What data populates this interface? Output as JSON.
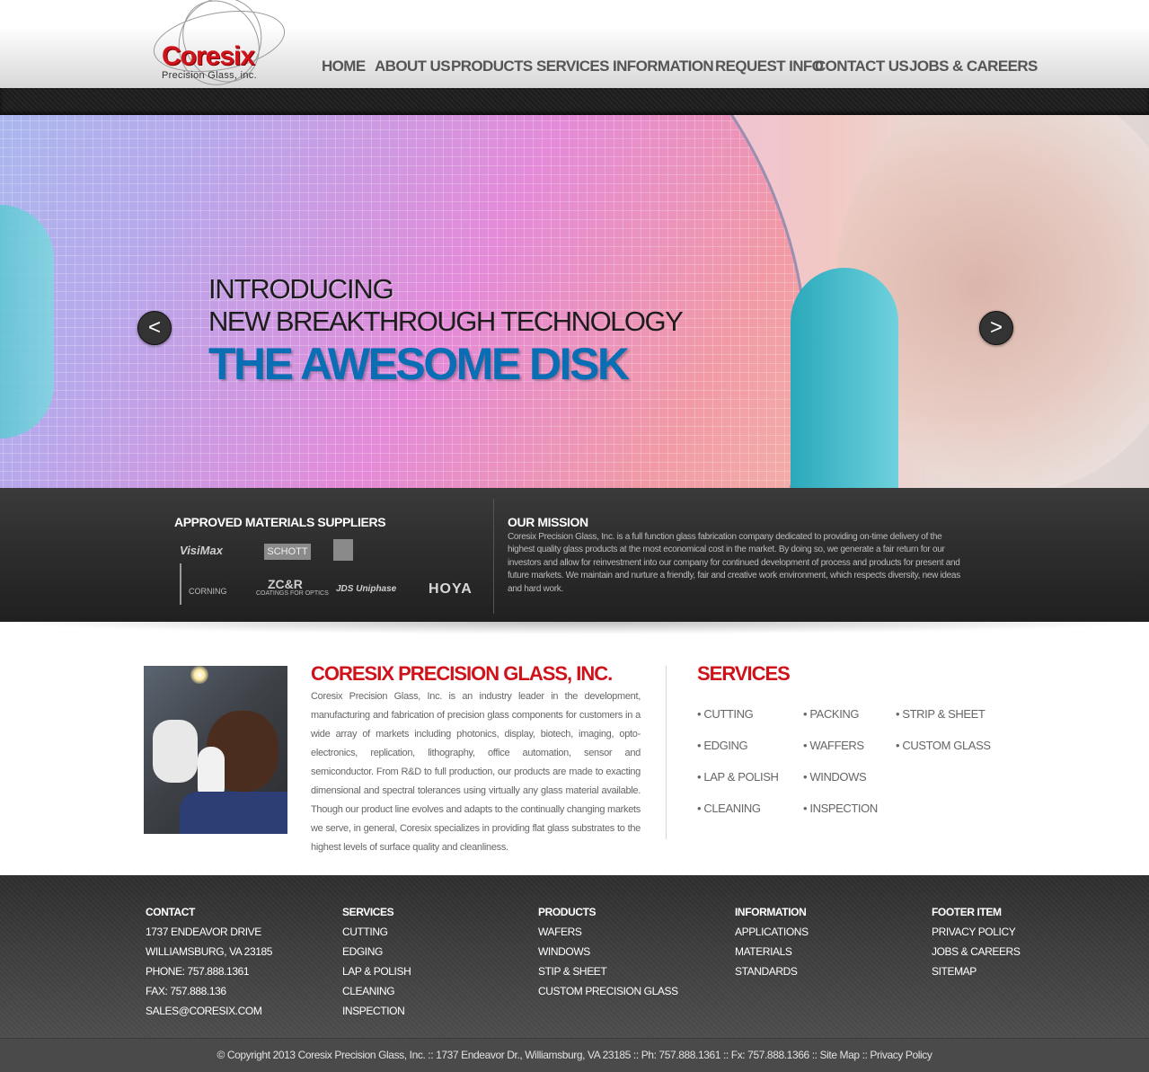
{
  "logo": {
    "name": "Coresix",
    "tagline": "Precision Glass, inc."
  },
  "nav": {
    "items": [
      "HOME",
      "ABOUT US",
      "PRODUCTS",
      "SERVICES",
      "INFORMATION",
      "REQUEST INFO",
      "CONTACT US",
      "JOBS & CAREERS"
    ]
  },
  "hero": {
    "line1": "INTRODUCING",
    "line2": "NEW BREAKTHROUGH TECHNOLOGY",
    "line3": "THE AWESOME DISK",
    "prev_label": "<",
    "next_label": ">",
    "accent_color": "#0a6eb4"
  },
  "suppliers": {
    "title": "APPROVED MATERIALS SUPPLIERS",
    "logos": [
      "VisiMax",
      "SCHOTT",
      "CORNING",
      "ZC&R",
      "COATINGS FOR OPTICS",
      "JDS Uniphase",
      "HOYA"
    ]
  },
  "mission": {
    "title": "OUR MISSION",
    "text": "Coresix Precision Glass, Inc. is a full function glass fabrication company dedicated to providing on-time delivery of the highest quality glass products at the most economical cost in the market. By doing so, we generate a fair return for our investors and allow for reinvestment into our company for continued development of process and products for present and future markets. We maintain and nurture a friendly, fair and creative work environment, which respects diversity, new ideas and hard work."
  },
  "company": {
    "title": "CORESIX PRECISION GLASS, INC.",
    "text": "Coresix Precision Glass, Inc. is an industry leader in the development, manufacturing and fabrication of precision glass components for customers in a wide array of markets including photonics, display, biotech, imaging, opto-electronics, replication, lithography, office automation, sensor and semiconductor. From R&D to full production, our products are made to exacting dimensional and spectral tolerances using virtually any glass material available. Though our product line evolves and adapts to the continually changing markets we serve, in general, Coresix specializes in providing flat glass substrates to the highest levels of surface quality and cleanliness.",
    "brand_color": "#d0121b"
  },
  "services": {
    "title": "SERVICES",
    "items": [
      "• CUTTING",
      "• PACKING",
      "• STRIP & SHEET",
      "• EDGING",
      "• WAFFERS",
      "• CUSTOM GLASS",
      "• LAP & POLISH",
      "• WINDOWS",
      "• CLEANING",
      "• INSPECTION"
    ]
  },
  "footer": {
    "contact": {
      "title": "CONTACT",
      "items": [
        "1737 ENDEAVOR DRIVE",
        "WILLIAMSBURG, VA 23185",
        "PHONE: 757.888.1361",
        "FAX: 757.888.136",
        "SALES@CORESIX.COM"
      ]
    },
    "services": {
      "title": "SERVICES",
      "items": [
        "CUTTING",
        "EDGING",
        "LAP & POLISH",
        "CLEANING",
        "INSPECTION"
      ]
    },
    "products": {
      "title": "PRODUCTS",
      "items": [
        "WAFERS",
        "WINDOWS",
        "STIP & SHEET",
        "CUSTOM PRECISION GLASS"
      ]
    },
    "information": {
      "title": "INFORMATION",
      "items": [
        "APPLICATIONS",
        "MATERIALS",
        "STANDARDS"
      ]
    },
    "footer_item": {
      "title": "FOOTER ITEM",
      "items": [
        "PRIVACY POLICY",
        "JOBS & CAREERS",
        "SITEMAP"
      ]
    },
    "copyright": "© Copyright 2013 Coresix Precision Glass, Inc. :: 1737 Endeavor Dr., Williamsburg, VA 23185 :: Ph: 757.888.1361 :: Fx: 757.888.1366 :: Site Map :: Privacy Policy"
  }
}
